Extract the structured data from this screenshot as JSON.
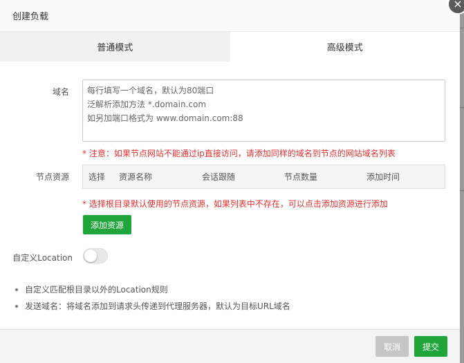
{
  "dialog": {
    "title": "创建负载",
    "close_glyph": "×"
  },
  "tabs": [
    {
      "label": "普通模式",
      "active": false
    },
    {
      "label": "高级模式",
      "active": true
    }
  ],
  "form": {
    "domain": {
      "label": "域名",
      "placeholder_lines": [
        "每行填写一个域名，默认为80端口",
        "泛解析添加方法 *.domain.com",
        "如另加端口格式为 www.domain.com:88"
      ],
      "hint": "* 注意：如果节点网站不能通过ip直接访问，请添加同样的域名到节点的网站域名列表"
    },
    "resources": {
      "label": "节点资源",
      "columns": [
        "选择",
        "资源名称",
        "会话跟随",
        "节点数量",
        "添加时间"
      ],
      "hint": "* 选择根目录默认使用的节点资源，如果列表中不存在，可以点击添加资源进行添加",
      "add_button": "添加资源"
    },
    "location": {
      "label": "自定义Location",
      "enabled": false
    }
  },
  "notes": [
    "自定义匹配根目录以外的Location规则",
    "发送域名：将域名添加到请求头传递到代理服务器，默认为目标URL域名"
  ],
  "footer": {
    "cancel_label": "取消",
    "submit_label": "提交"
  },
  "colors": {
    "accent": "#20a53a",
    "hint": "#e03131"
  }
}
